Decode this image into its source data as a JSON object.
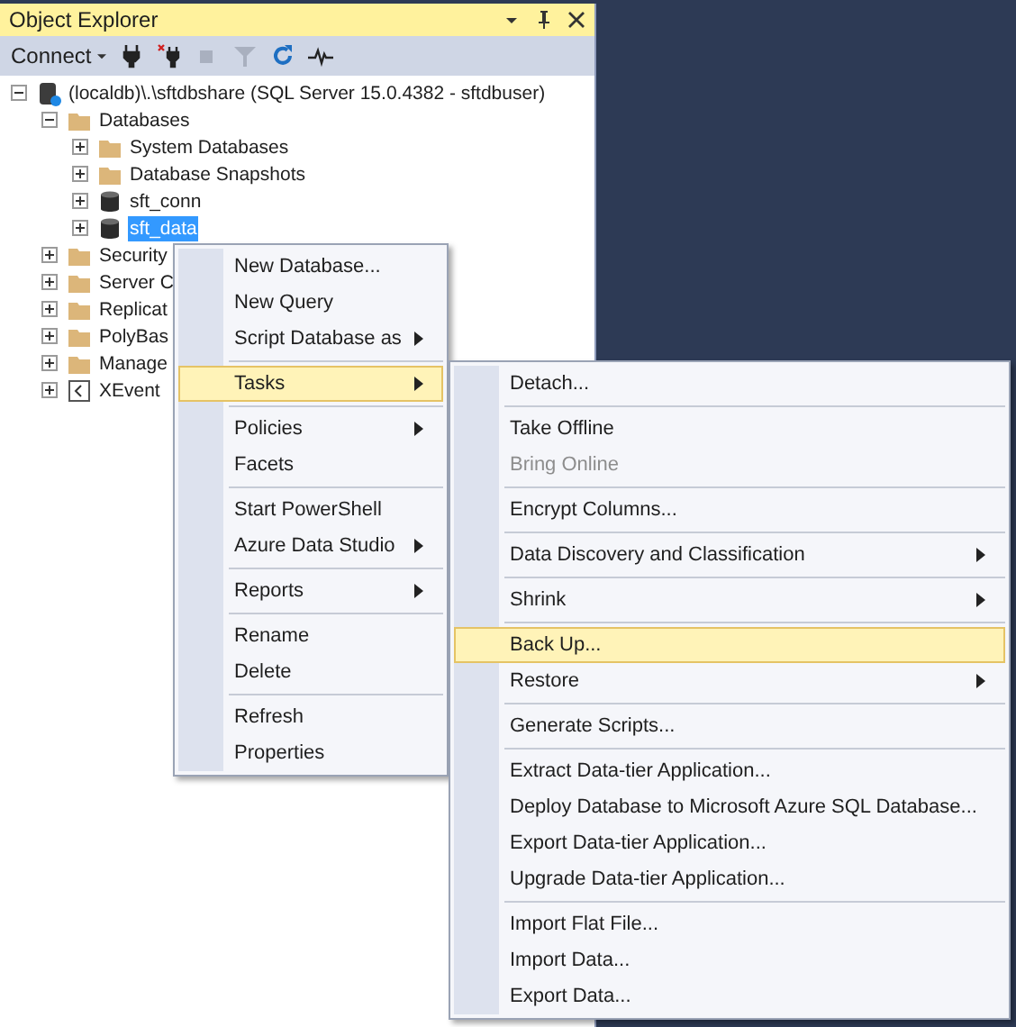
{
  "panel": {
    "title": "Object Explorer"
  },
  "toolbar": {
    "connect": "Connect"
  },
  "tree": [
    {
      "label": "(localdb)\\.\\sftdbshare (SQL Server 15.0.4382 - sftdbuser)",
      "kind": "server",
      "expanded": true,
      "selected": false,
      "children": [
        {
          "label": "Databases",
          "kind": "folder",
          "expanded": true,
          "selected": false,
          "children": [
            {
              "label": "System Databases",
              "kind": "folder",
              "expanded": false,
              "selected": false
            },
            {
              "label": "Database Snapshots",
              "kind": "folder",
              "expanded": false,
              "selected": false
            },
            {
              "label": "sft_conn",
              "kind": "database",
              "expanded": false,
              "selected": false
            },
            {
              "label": "sft_data",
              "kind": "database",
              "expanded": false,
              "selected": true
            }
          ]
        },
        {
          "label": "Security",
          "kind": "folder",
          "expanded": false,
          "selected": false
        },
        {
          "label": "Server C",
          "kind": "folder",
          "expanded": false,
          "selected": false
        },
        {
          "label": "Replicat",
          "kind": "folder",
          "expanded": false,
          "selected": false
        },
        {
          "label": "PolyBas",
          "kind": "folder",
          "expanded": false,
          "selected": false
        },
        {
          "label": "Manage",
          "kind": "folder",
          "expanded": false,
          "selected": false
        },
        {
          "label": "XEvent",
          "kind": "xevent",
          "expanded": false,
          "selected": false
        }
      ]
    }
  ],
  "context_menu": [
    [
      {
        "label": "New Database...",
        "submenu": false,
        "selected": false,
        "disabled": false
      },
      {
        "label": "New Query",
        "submenu": false,
        "selected": false,
        "disabled": false
      },
      {
        "label": "Script Database as",
        "submenu": true,
        "selected": false,
        "disabled": false
      }
    ],
    [
      {
        "label": "Tasks",
        "submenu": true,
        "selected": true,
        "disabled": false
      }
    ],
    [
      {
        "label": "Policies",
        "submenu": true,
        "selected": false,
        "disabled": false
      },
      {
        "label": "Facets",
        "submenu": false,
        "selected": false,
        "disabled": false
      }
    ],
    [
      {
        "label": "Start PowerShell",
        "submenu": false,
        "selected": false,
        "disabled": false
      },
      {
        "label": "Azure Data Studio",
        "submenu": true,
        "selected": false,
        "disabled": false
      }
    ],
    [
      {
        "label": "Reports",
        "submenu": true,
        "selected": false,
        "disabled": false
      }
    ],
    [
      {
        "label": "Rename",
        "submenu": false,
        "selected": false,
        "disabled": false
      },
      {
        "label": "Delete",
        "submenu": false,
        "selected": false,
        "disabled": false
      }
    ],
    [
      {
        "label": "Refresh",
        "submenu": false,
        "selected": false,
        "disabled": false
      },
      {
        "label": "Properties",
        "submenu": false,
        "selected": false,
        "disabled": false
      }
    ]
  ],
  "tasks_submenu": [
    [
      {
        "label": "Detach...",
        "submenu": false,
        "selected": false,
        "disabled": false
      }
    ],
    [
      {
        "label": "Take Offline",
        "submenu": false,
        "selected": false,
        "disabled": false
      },
      {
        "label": "Bring Online",
        "submenu": false,
        "selected": false,
        "disabled": true
      }
    ],
    [
      {
        "label": "Encrypt Columns...",
        "submenu": false,
        "selected": false,
        "disabled": false
      }
    ],
    [
      {
        "label": "Data Discovery and Classification",
        "submenu": true,
        "selected": false,
        "disabled": false
      }
    ],
    [
      {
        "label": "Shrink",
        "submenu": true,
        "selected": false,
        "disabled": false
      }
    ],
    [
      {
        "label": "Back Up...",
        "submenu": false,
        "selected": true,
        "disabled": false
      },
      {
        "label": "Restore",
        "submenu": true,
        "selected": false,
        "disabled": false
      }
    ],
    [
      {
        "label": "Generate Scripts...",
        "submenu": false,
        "selected": false,
        "disabled": false
      }
    ],
    [
      {
        "label": "Extract Data-tier Application...",
        "submenu": false,
        "selected": false,
        "disabled": false
      },
      {
        "label": "Deploy Database to Microsoft Azure SQL Database...",
        "submenu": false,
        "selected": false,
        "disabled": false
      },
      {
        "label": "Export Data-tier Application...",
        "submenu": false,
        "selected": false,
        "disabled": false
      },
      {
        "label": "Upgrade Data-tier Application...",
        "submenu": false,
        "selected": false,
        "disabled": false
      }
    ],
    [
      {
        "label": "Import Flat File...",
        "submenu": false,
        "selected": false,
        "disabled": false
      },
      {
        "label": "Import Data...",
        "submenu": false,
        "selected": false,
        "disabled": false
      },
      {
        "label": "Export Data...",
        "submenu": false,
        "selected": false,
        "disabled": false
      }
    ]
  ]
}
